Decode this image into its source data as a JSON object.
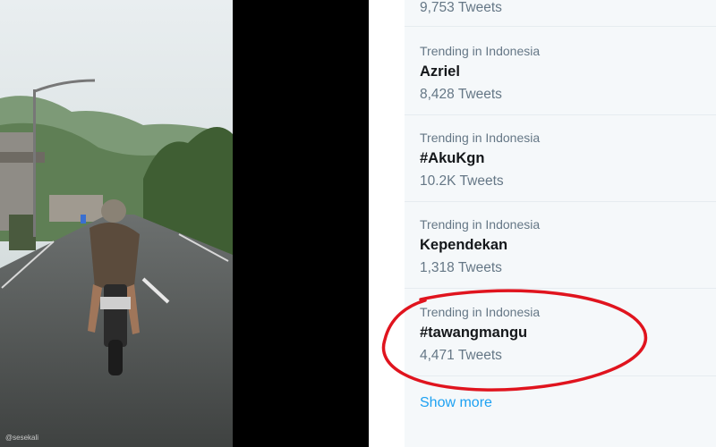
{
  "video": {
    "watermark": "@sesekali"
  },
  "trends": {
    "items": [
      {
        "context": "",
        "name": "",
        "count": "9,753 Tweets"
      },
      {
        "context": "Trending in Indonesia",
        "name": "Azriel",
        "count": "8,428 Tweets"
      },
      {
        "context": "Trending in Indonesia",
        "name": "#AkuKgn",
        "count": "10.2K Tweets"
      },
      {
        "context": "Trending in Indonesia",
        "name": "Kependekan",
        "count": "1,318 Tweets"
      },
      {
        "context": "Trending in Indonesia",
        "name": "#tawangmangu",
        "count": "4,471 Tweets"
      }
    ],
    "show_more": "Show more"
  },
  "colors": {
    "panel_bg": "#f5f8fa",
    "link": "#1da1f2",
    "highlight": "#e0141e"
  }
}
